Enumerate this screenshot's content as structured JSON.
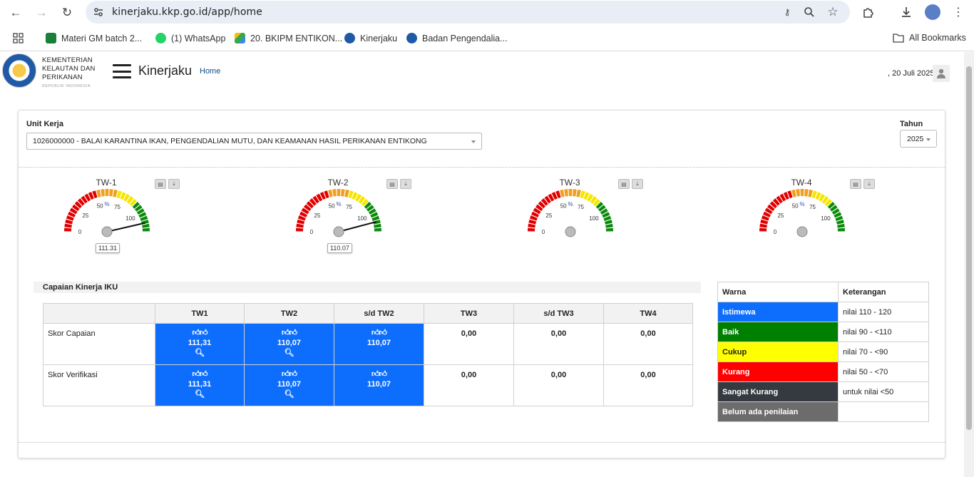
{
  "browser": {
    "url": "kinerjaku.kkp.go.id/app/home",
    "bookmarks": [
      {
        "label": "Materi GM batch 2...",
        "color": "#188038"
      },
      {
        "label": "(1) WhatsApp",
        "color": "#25d366"
      },
      {
        "label": "20. BKIPM ENTIKON...",
        "color": "#fbbc04"
      },
      {
        "label": "Kinerjaku",
        "color": "#1f5aa6"
      },
      {
        "label": "Badan Pengendalia...",
        "color": "#1f5aa6"
      }
    ],
    "all_bookmarks": "All Bookmarks"
  },
  "header": {
    "logo_lines": [
      "KEMENTERIAN",
      "KELAUTAN DAN",
      "PERIKANAN"
    ],
    "logo_sub": "REPUBLIK INDONESIA",
    "app_title": "Kinerjaku",
    "breadcrumb": "Home",
    "date": ", 20 Juli 2025"
  },
  "filters": {
    "unit_label": "Unit Kerja",
    "unit_value": "1026000000 - BALAI KARANTINA IKAN, PENGENDALIAN MUTU, DAN KEAMANAN HASIL PERIKANAN ENTIKONG",
    "tahun_label": "Tahun",
    "tahun_value": "2025"
  },
  "gauges": [
    {
      "title": "TW-1",
      "value": 111.31,
      "label": "111.31",
      "has_needle": true
    },
    {
      "title": "TW-2",
      "value": 110.07,
      "label": "110.07",
      "has_needle": true
    },
    {
      "title": "TW-3",
      "value": null,
      "label": "",
      "has_needle": false
    },
    {
      "title": "TW-4",
      "value": null,
      "label": "",
      "has_needle": false
    }
  ],
  "gauge_scale": {
    "ticks": [
      "0",
      "25",
      "50",
      "75",
      "100"
    ],
    "unit": "%"
  },
  "iku": {
    "title": "Capaian Kinerja IKU",
    "columns": [
      "",
      "TW1",
      "TW2",
      "s/d TW2",
      "TW3",
      "s/d TW3",
      "TW4"
    ],
    "rows": [
      {
        "label": "Skor Capaian",
        "tw1": "111,31",
        "tw2": "110,07",
        "sd_tw2": "110,07",
        "tw3": "0,00",
        "sd_tw3": "0,00",
        "tw4": "0,00"
      },
      {
        "label": "Skor Verifikasi",
        "tw1": "111,31",
        "tw2": "110,07",
        "sd_tw2": "110,07",
        "tw3": "0,00",
        "sd_tw3": "0,00",
        "tw4": "0,00"
      }
    ]
  },
  "legend": {
    "headers": [
      "Warna",
      "Keterangan"
    ],
    "rows": [
      {
        "name": "Istimewa",
        "desc": "nilai 110 - 120",
        "color": "#0d6efd",
        "text": "#ffffff"
      },
      {
        "name": "Baik",
        "desc": "nilai 90 - <110",
        "color": "#008000",
        "text": "#ffffff"
      },
      {
        "name": "Cukup",
        "desc": "nilai 70 - <90",
        "color": "#ffff00",
        "text": "#222222"
      },
      {
        "name": "Kurang",
        "desc": "nilai 50 - <70",
        "color": "#ff0000",
        "text": "#ffffff"
      },
      {
        "name": "Sangat Kurang",
        "desc": "untuk nilai <50",
        "color": "#343a40",
        "text": "#ffffff"
      },
      {
        "name": "Belum ada penilaian",
        "desc": "",
        "color": "#6c6c6c",
        "text": "#ffffff"
      }
    ]
  }
}
